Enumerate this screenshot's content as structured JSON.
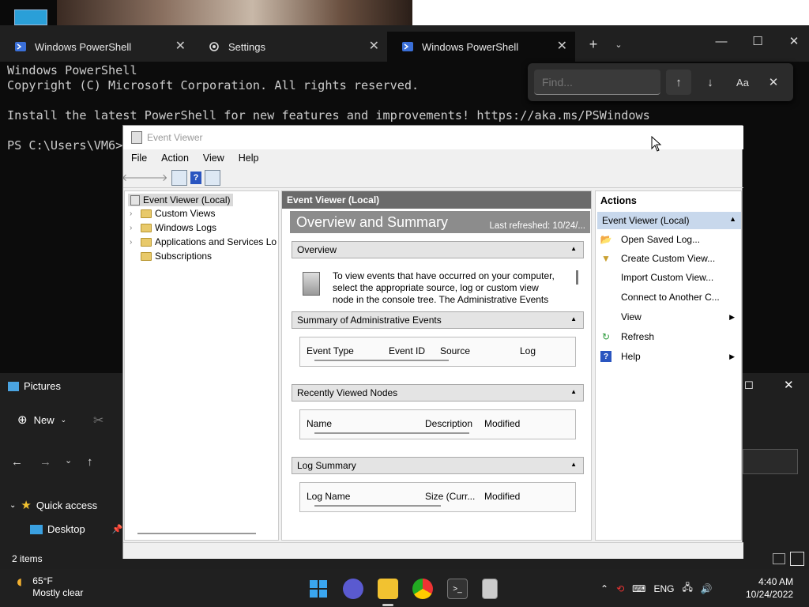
{
  "terminal": {
    "tabs": [
      {
        "label": "Windows PowerShell"
      },
      {
        "label": "Settings"
      },
      {
        "label": "Windows PowerShell"
      }
    ],
    "lines": "Windows PowerShell\nCopyright (C) Microsoft Corporation. All rights reserved.\n\nInstall the latest PowerShell for new features and improvements! https://aka.ms/PSWindows\n\nPS C:\\Users\\VM6>",
    "find_placeholder": "Find...",
    "find_case_label": "Aa"
  },
  "explorer": {
    "title": "Pictures",
    "new_label": "New",
    "quick_access": "Quick access",
    "desktop": "Desktop",
    "items_count": "2 items"
  },
  "event_viewer": {
    "title": "Event Viewer",
    "menu": [
      "File",
      "Action",
      "View",
      "Help"
    ],
    "tree": {
      "root": "Event Viewer (Local)",
      "children": [
        "Custom Views",
        "Windows Logs",
        "Applications and Services Lo",
        "Subscriptions"
      ]
    },
    "center": {
      "header": "Event Viewer (Local)",
      "band_title": "Overview and Summary",
      "last_refreshed": "Last refreshed: 10/24/...",
      "overview_label": "Overview",
      "overview_text": "To view events that have occurred on your computer, select the appropriate source, log or custom view node in the console tree. The Administrative Events",
      "summary_label": "Summary of Administrative Events",
      "summary_cols": [
        "Event Type",
        "Event ID",
        "Source",
        "Log"
      ],
      "recent_label": "Recently Viewed Nodes",
      "recent_cols": [
        "Name",
        "Description",
        "Modified"
      ],
      "logsum_label": "Log Summary",
      "logsum_cols": [
        "Log Name",
        "Size (Curr...",
        "Modified"
      ]
    },
    "actions": {
      "header": "Actions",
      "sub_header": "Event Viewer (Local)",
      "items": [
        "Open Saved Log...",
        "Create Custom View...",
        "Import Custom View...",
        "Connect to Another C...",
        "View",
        "Refresh",
        "Help"
      ]
    }
  },
  "taskbar": {
    "temp": "65°F",
    "weather": "Mostly clear",
    "lang": "ENG",
    "time": "4:40 AM",
    "date": "10/24/2022"
  }
}
